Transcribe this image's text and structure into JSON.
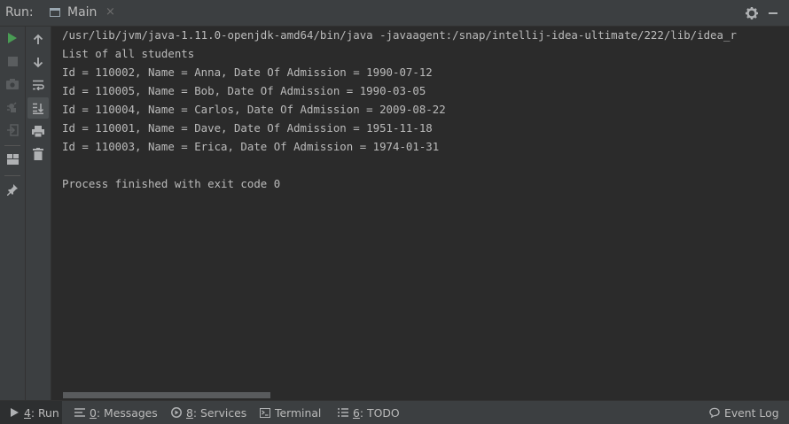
{
  "header": {
    "run_label": "Run:",
    "tab_label": "Main",
    "tab_close": "×"
  },
  "console": {
    "lines": [
      "/usr/lib/jvm/java-1.11.0-openjdk-amd64/bin/java -javaagent:/snap/intellij-idea-ultimate/222/lib/idea_r",
      "List of all students",
      "Id = 110002, Name = Anna, Date Of Admission = 1990-07-12",
      "Id = 110005, Name = Bob, Date Of Admission = 1990-03-05",
      "Id = 110004, Name = Carlos, Date Of Admission = 2009-08-22",
      "Id = 110001, Name = Dave, Date Of Admission = 1951-11-18",
      "Id = 110003, Name = Erica, Date Of Admission = 1974-01-31",
      "",
      "Process finished with exit code 0"
    ]
  },
  "bottom_bar": {
    "run": {
      "mnemonic": "4",
      "label": ": Run"
    },
    "messages": {
      "mnemonic": "0",
      "label": ": Messages"
    },
    "services": {
      "mnemonic": "8",
      "label": ": Services"
    },
    "terminal": {
      "label": "Terminal"
    },
    "todo": {
      "mnemonic": "6",
      "label": ": TODO"
    },
    "event_log": {
      "label": "Event Log"
    }
  },
  "colors": {
    "background": "#2b2b2b",
    "panel": "#3c3f41",
    "text": "#bbbbbb",
    "run_green": "#499c54"
  },
  "icons": [
    "run-icon",
    "stop-icon",
    "camera-icon",
    "debug-icon",
    "exit-icon",
    "layout-icon",
    "pin-icon",
    "up-arrow-icon",
    "down-arrow-icon",
    "soft-wrap-icon",
    "scroll-to-end-icon",
    "print-icon",
    "trash-icon",
    "gear-icon",
    "minimize-icon"
  ]
}
